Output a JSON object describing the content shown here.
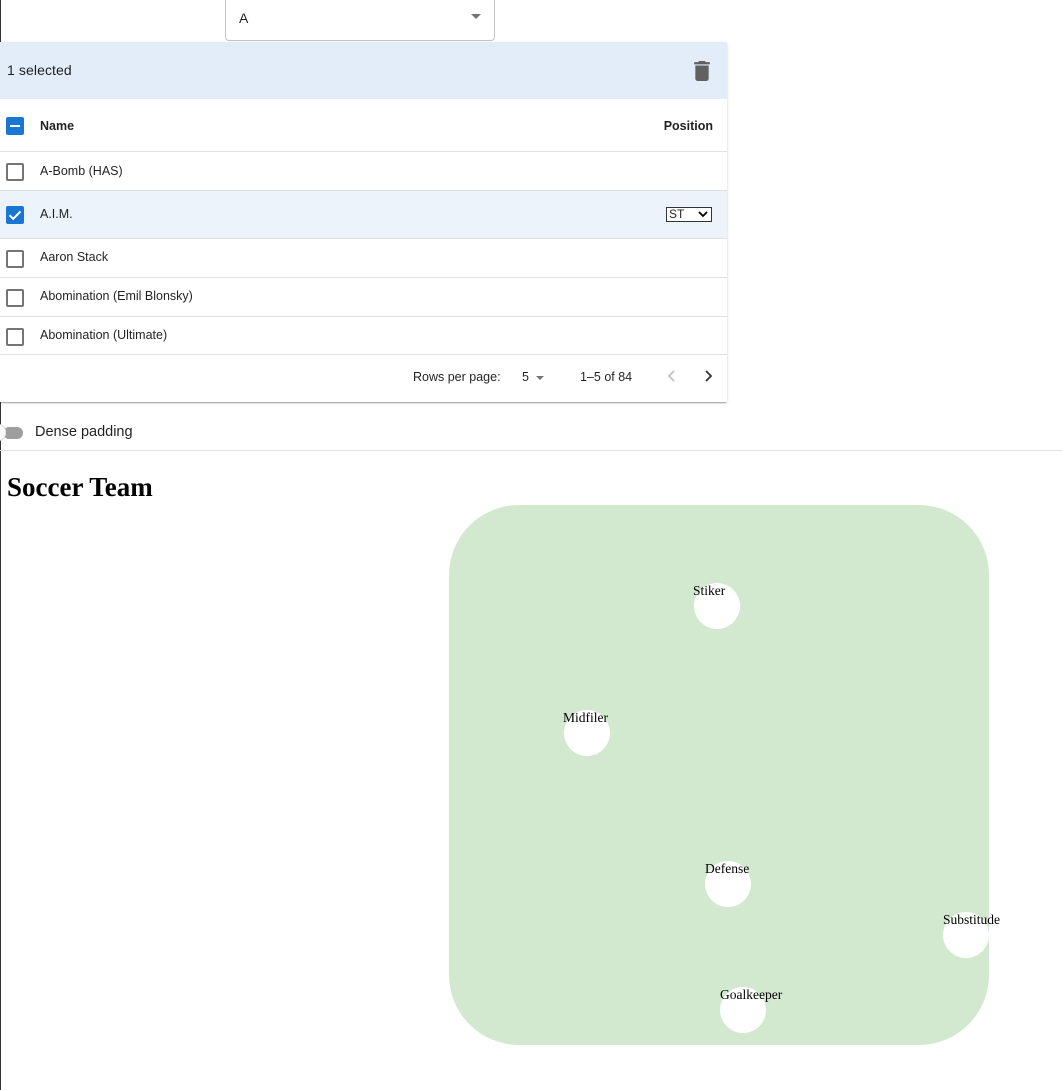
{
  "filter_select": {
    "value": "A"
  },
  "toolbar": {
    "selected_text": "1 selected",
    "delete_icon": "trash-icon"
  },
  "table": {
    "columns": {
      "name": "Name",
      "position": "Position"
    },
    "rows": [
      {
        "name": "A-Bomb (HAS)",
        "checked": false,
        "position": ""
      },
      {
        "name": "A.I.M.",
        "checked": true,
        "position": "ST"
      },
      {
        "name": "Aaron Stack",
        "checked": false,
        "position": ""
      },
      {
        "name": "Abomination (Emil Blonsky)",
        "checked": false,
        "position": ""
      },
      {
        "name": "Abomination (Ultimate)",
        "checked": false,
        "position": ""
      }
    ]
  },
  "pagination": {
    "rows_per_page_label": "Rows per page:",
    "rows_per_page": "5",
    "range": "1–5 of 84"
  },
  "dense_toggle": {
    "label": "Dense padding",
    "on": false
  },
  "team": {
    "title": "Soccer Team",
    "positions": [
      "Stiker",
      "Midfiler",
      "Defense",
      "Substitude",
      "Goalkeeper"
    ]
  },
  "colors": {
    "accent": "#1976d2",
    "selected_bg": "#edf3fb",
    "toolbar_bg": "#e3edf9",
    "field": "#d2e9d0"
  }
}
